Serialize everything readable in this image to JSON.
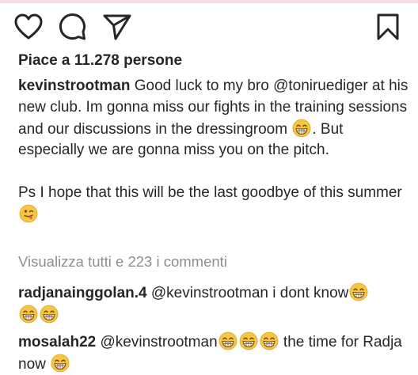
{
  "post": {
    "likes_text": "Piace a 11.278 persone",
    "caption": {
      "username": "kevinstrootman",
      "text_1": " Good luck to my bro ",
      "mention": "@toniruediger",
      "text_2": " at his new club. Im gonna miss our fights in the training sessions  and our discussions in the dressingroom ",
      "text_3": ". But especially we are gonna miss you on the pitch.",
      "ps_text": "Ps I hope that this will be the last goodbye of this summer"
    },
    "view_all_comments": "Visualizza tutti e 223 i commenti",
    "comments": [
      {
        "username": "radjanainggolan.4",
        "mention": "@kevinstrootman",
        "text": " i dont know"
      },
      {
        "username": "mosalah22",
        "mention": "@kevinstrootman",
        "text_after_emojis": " the time for Radja now "
      }
    ]
  },
  "icons": {
    "like": "heart-icon",
    "comment": "comment-bubble-icon",
    "share": "paper-plane-icon",
    "save": "bookmark-icon",
    "emoji_grin": "grinning-face-emoji",
    "emoji_wink": "winking-tongue-face-emoji"
  },
  "colors": {
    "text": "#262626",
    "muted": "#8e8e8e",
    "emoji_yellow": "#f6c642"
  }
}
